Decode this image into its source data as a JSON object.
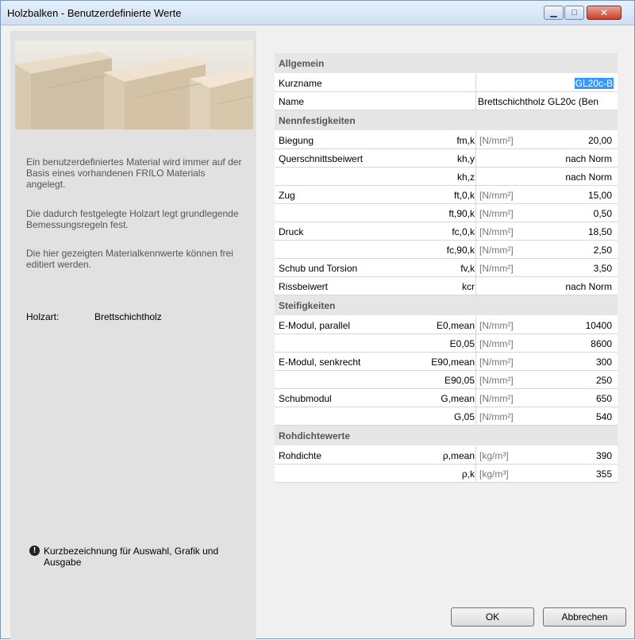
{
  "window": {
    "title": "Holzbalken - Benutzerdefinierte Werte",
    "min_icon": "minimize-icon",
    "max_icon": "maximize-icon",
    "close_icon": "close-icon"
  },
  "left": {
    "desc1": "Ein benutzerdefiniertes Material wird immer auf der Basis eines vorhandenen FRILO Materials angelegt.",
    "desc2": "Die dadurch festgelegte Holzart legt grundlegende Bemessungsregeln fest.",
    "desc3": "Die hier gezeigten Materialkennwerte können frei editiert werden.",
    "holzart_label": "Holzart:",
    "holzart_value": "Brettschichtholz",
    "info_text": "Kurzbezeichnung für Auswahl, Grafik und Ausgabe"
  },
  "sections": {
    "allgemein": "Allgemein",
    "nenn": "Nennfestigkeiten",
    "steif": "Steifigkeiten",
    "rohdichte": "Rohdichtewerte"
  },
  "allgemein": {
    "kurzname_label": "Kurzname",
    "kurzname_value": "GL20c-B",
    "name_label": "Name",
    "name_value": "Brettschichtholz GL20c (Ben"
  },
  "nenn_rows": [
    {
      "label": "Biegung",
      "sym": "fm,k",
      "unit": "[N/mm²]",
      "value": "20,00"
    },
    {
      "label": "Querschnittsbeiwert",
      "sym": "kh,y",
      "unit": "",
      "value": "nach Norm"
    },
    {
      "label": "",
      "sym": "kh,z",
      "unit": "",
      "value": "nach Norm"
    },
    {
      "label": "Zug",
      "sym": "ft,0,k",
      "unit": "[N/mm²]",
      "value": "15,00"
    },
    {
      "label": "",
      "sym": "ft,90,k",
      "unit": "[N/mm²]",
      "value": "0,50"
    },
    {
      "label": "Druck",
      "sym": "fc,0,k",
      "unit": "[N/mm²]",
      "value": "18,50"
    },
    {
      "label": "",
      "sym": "fc,90,k",
      "unit": "[N/mm²]",
      "value": "2,50"
    },
    {
      "label": "Schub und Torsion",
      "sym": "fv,k",
      "unit": "[N/mm²]",
      "value": "3,50"
    },
    {
      "label": "Rissbeiwert",
      "sym": "kcr",
      "unit": "",
      "value": "nach Norm"
    }
  ],
  "steif_rows": [
    {
      "label": "E-Modul, parallel",
      "sym": "E0,mean",
      "unit": "[N/mm²]",
      "value": "10400"
    },
    {
      "label": "",
      "sym": "E0,05",
      "unit": "[N/mm²]",
      "value": "8600"
    },
    {
      "label": "E-Modul, senkrecht",
      "sym": "E90,mean",
      "unit": "[N/mm²]",
      "value": "300"
    },
    {
      "label": "",
      "sym": "E90,05",
      "unit": "[N/mm²]",
      "value": "250"
    },
    {
      "label": "Schubmodul",
      "sym": "G,mean",
      "unit": "[N/mm²]",
      "value": "650"
    },
    {
      "label": "",
      "sym": "G,05",
      "unit": "[N/mm²]",
      "value": "540"
    }
  ],
  "rohdichte_rows": [
    {
      "label": "Rohdichte",
      "sym": "ρ,mean",
      "unit": "[kg/m³]",
      "value": "390"
    },
    {
      "label": "",
      "sym": "ρ,k",
      "unit": "[kg/m³]",
      "value": "355"
    }
  ],
  "buttons": {
    "ok": "OK",
    "cancel": "Abbrechen"
  }
}
